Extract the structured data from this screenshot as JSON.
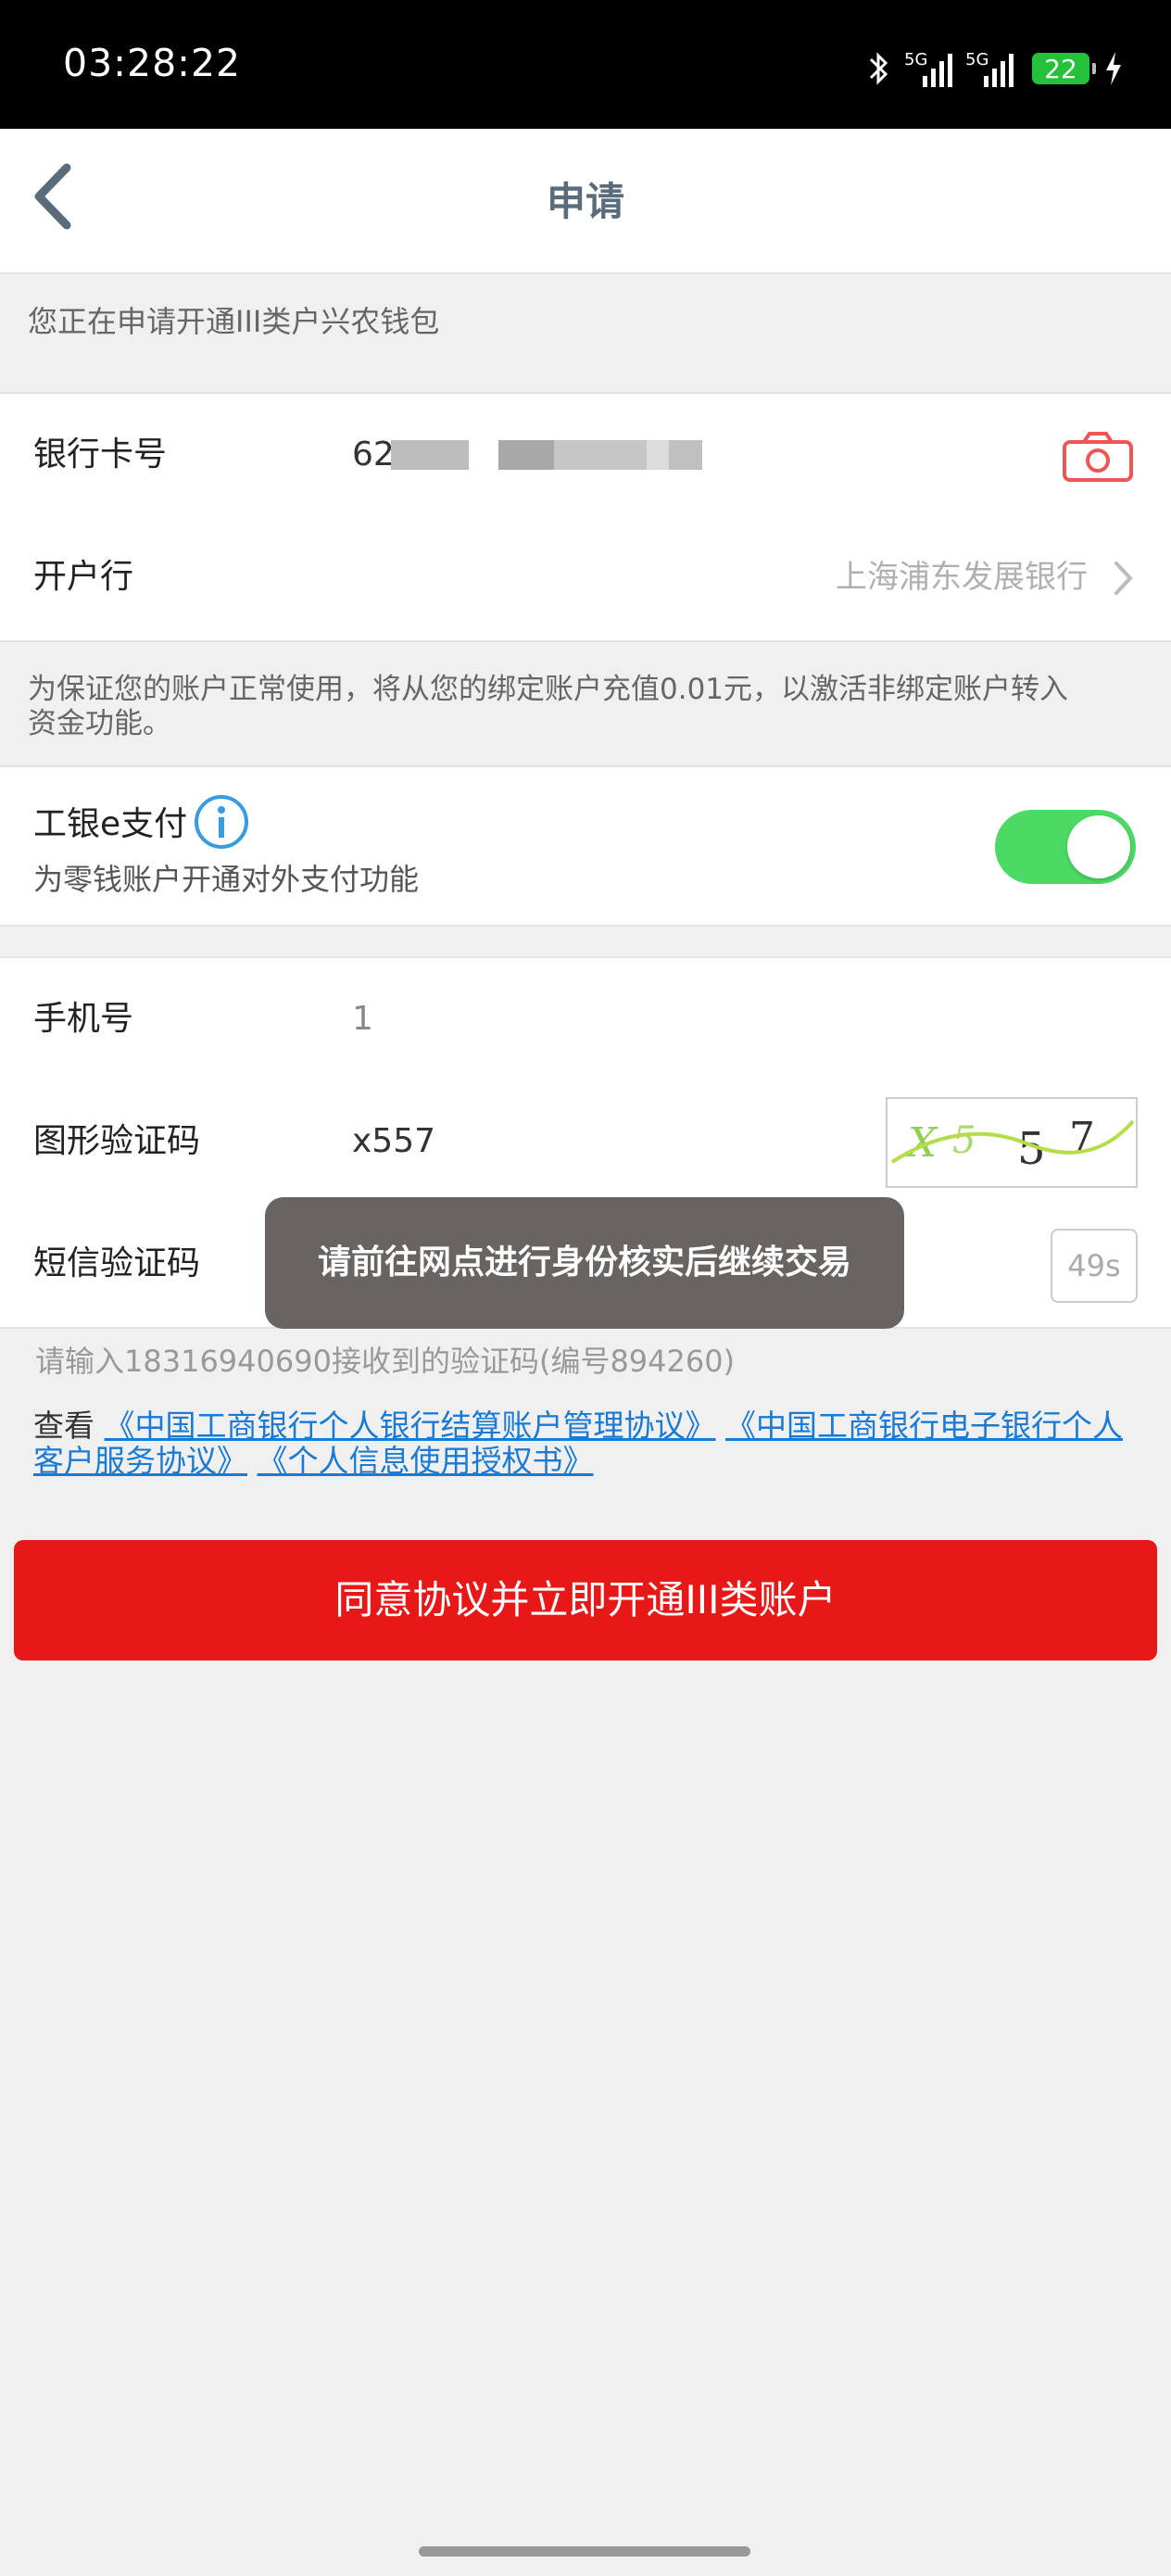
{
  "status_bar": {
    "time": "03:28:22",
    "battery": "22",
    "signal1": "5G",
    "signal2": "5G"
  },
  "nav": {
    "title": "申请"
  },
  "intro_note": "您正在申请开通III类户兴农钱包",
  "card_section": {
    "card_label": "银行卡号",
    "card_value": "62",
    "bank_label": "开户行",
    "bank_value": "上海浦东发展银行"
  },
  "activation_note_line1": "为保证您的账户正常使用，将从您的绑定账户充值0.01元，以激活非绑定账户转入",
  "activation_note_line2": "资金功能。",
  "epay": {
    "label": "工银e支付",
    "desc": "为零钱账户开通对外支付功能",
    "enabled": true
  },
  "form": {
    "phone_label": "手机号",
    "phone_value": "1",
    "captcha_label": "图形验证码",
    "captcha_value": "x557",
    "captcha_image_text": "X557",
    "sms_label": "短信验证码",
    "sms_timer": "49s"
  },
  "toast": "请前往网点进行身份核实后继续交易",
  "sms_hint": "请输入18316940690接收到的验证码(编号894260)",
  "agreements": {
    "prefix": "查看",
    "link1": "《中国工商银行个人银行结算账户管理协议》",
    "link2": "《中国工商银行电子银行个人客户服务协议》",
    "link3": "《个人信息使用授权书》"
  },
  "submit_label": "同意协议并立即开通III类账户",
  "colors": {
    "primary_red": "#e81819",
    "toggle_green": "#4cd964",
    "link_blue": "#1a7ad4"
  }
}
